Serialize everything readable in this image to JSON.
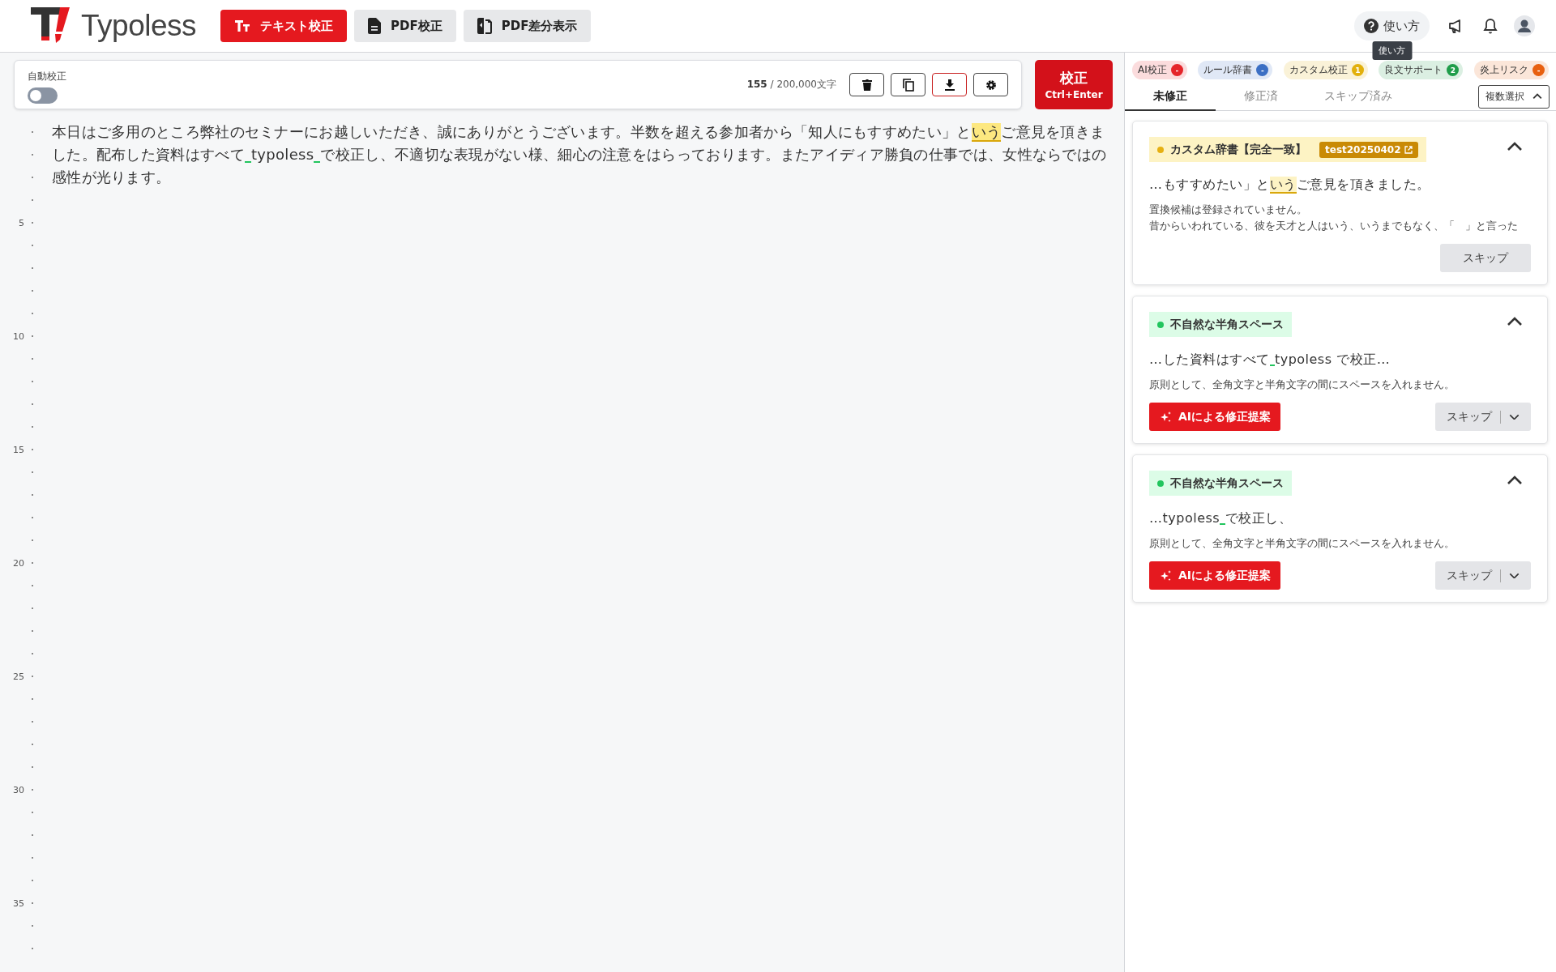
{
  "header": {
    "brand": "Typoless",
    "nav": [
      {
        "label": "テキスト校正",
        "selected": true
      },
      {
        "label": "PDF校正",
        "selected": false
      },
      {
        "label": "PDF差分表示",
        "selected": false
      }
    ],
    "help": {
      "label": "使い方",
      "tooltip": "使い方"
    }
  },
  "toolbar": {
    "auto_correct": {
      "label": "自動校正",
      "on": false
    },
    "count": "155",
    "limit": "/ 200,000文字",
    "run_button": {
      "label": "校正",
      "shortcut": "Ctrl+Enter"
    }
  },
  "editor": {
    "line_numbers": [
      "5",
      "10",
      "15",
      "20",
      "25",
      "30",
      "35"
    ],
    "segments": [
      {
        "kind": "plain",
        "text": "本日はご多用のところ弊社のセミナーにお越しいただき、誠にありがとうございます。半数を超える参加者から「知人にもすすめたい」と"
      },
      {
        "kind": "highlight",
        "text": "いう"
      },
      {
        "kind": "plain",
        "text": "ご意見を頂きました。配布した資料はすべて"
      },
      {
        "kind": "space"
      },
      {
        "kind": "plain",
        "text": "typoless"
      },
      {
        "kind": "space"
      },
      {
        "kind": "plain",
        "text": "で校正し、不適切な表現がない様、細心の注意をはらっております。またアイディア勝負の仕事では、女性ならではの感性が光ります。"
      }
    ]
  },
  "panel": {
    "filters": [
      {
        "label": "AI校正",
        "count": "-",
        "color": "#e5252a"
      },
      {
        "label": "ルール辞書",
        "count": "-",
        "color": "#3b6fc4"
      },
      {
        "label": "カスタム校正",
        "count": "1",
        "color": "#e2b00c"
      },
      {
        "label": "良文サポート",
        "count": "2",
        "color": "#1f9d4a"
      },
      {
        "label": "炎上リスク",
        "count": "-",
        "color": "#e8600f"
      }
    ],
    "tabs": [
      {
        "label": "未修正",
        "selected": true
      },
      {
        "label": "修正済",
        "selected": false
      },
      {
        "label": "スキップ済み",
        "selected": false
      }
    ],
    "multi_select": {
      "label": "複数選択",
      "expanded": true
    },
    "issues": [
      {
        "kind": "custom",
        "category": "カスタム辞書【完全一致】",
        "color": "#e6b012",
        "tag": "test20250402",
        "expanded": true,
        "excerpt": [
          {
            "kind": "plain",
            "text": "…もすすめたい」と"
          },
          {
            "kind": "highlight",
            "text": "いう"
          },
          {
            "kind": "plain",
            "text": "ご意見を頂きました。"
          }
        ],
        "messages": [
          "置換候補は登録されていません。",
          "昔からいわれている、彼を天才と人はいう、いうまでもなく、「　」と言った"
        ],
        "skip": {
          "label": "スキップ",
          "menu": false
        }
      },
      {
        "kind": "space",
        "category": "不自然な半角スペース",
        "color": "#22c55e",
        "expanded": true,
        "excerpt": [
          {
            "kind": "plain",
            "text": "…した資料はすべて"
          },
          {
            "kind": "space"
          },
          {
            "kind": "plain",
            "text": "typoless で校正…"
          }
        ],
        "messages": [
          "原則として、全角文字と半角文字の間にスペースを入れません。"
        ],
        "ai_button": "AIによる修正提案",
        "skip": {
          "label": "スキップ",
          "menu": true
        }
      },
      {
        "kind": "space",
        "category": "不自然な半角スペース",
        "color": "#22c55e",
        "expanded": true,
        "excerpt": [
          {
            "kind": "plain",
            "text": "…typoless"
          },
          {
            "kind": "space"
          },
          {
            "kind": "plain",
            "text": "で校正し、"
          }
        ],
        "messages": [
          "原則として、全角文字と半角文字の間にスペースを入れません。"
        ],
        "ai_button": "AIによる修正提案",
        "skip": {
          "label": "スキップ",
          "menu": true
        }
      }
    ]
  }
}
